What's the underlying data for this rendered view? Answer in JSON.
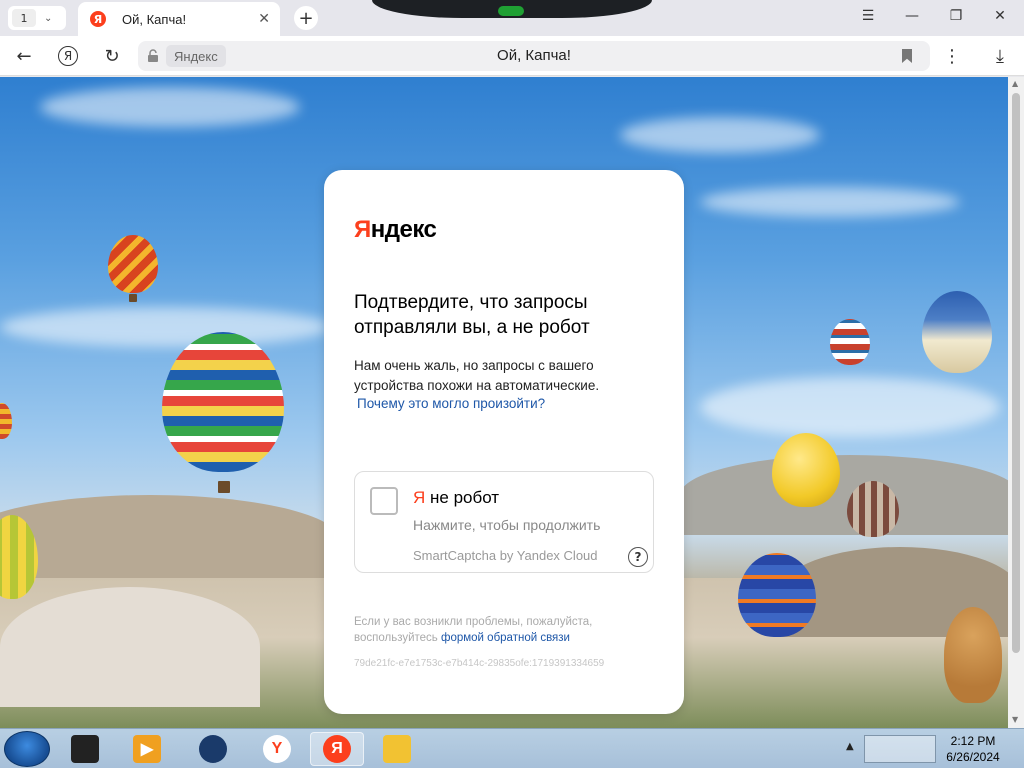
{
  "browser": {
    "tab_count": "1",
    "tab_title": "Ой, Капча!",
    "tab_favicon": "Я",
    "address_site_label": "Яндекс",
    "address_title": "Ой, Капча!"
  },
  "icons": {
    "back": "back-arrow-icon",
    "yandex": "yandex-circle-icon",
    "reload": "reload-icon",
    "lock": "lock-icon",
    "bookmark": "bookmark-icon",
    "menu": "kebab-menu-icon",
    "download": "download-icon"
  },
  "captcha": {
    "logo_red": "Я",
    "logo_rest": "ндекс",
    "heading": "Подтвердите, что запросы отправляли вы, а не робот",
    "description": "Нам очень жаль, но запросы с вашего устройства похожи на автоматические.",
    "why_link": "Почему это могло произойти?",
    "checkbox_label_red": "Я",
    "checkbox_label_rest": " не робот",
    "checkbox_hint": "Нажмите, чтобы продолжить",
    "brand": "SmartCaptcha by Yandex Cloud",
    "help": "?",
    "footer_text": "Если у вас возникли проблемы, пожалуйста, воспользуйтесь",
    "footer_link": "формой обратной связи",
    "request_id": "79de21fc-e7e1753c-e7b414c-29835ofe:1719391334659"
  },
  "taskbar": {
    "time": "2:12 PM",
    "date": "6/26/2024",
    "yandex_icon": "Я"
  },
  "colors": {
    "brand_red": "#fc3f1d",
    "link_blue": "#1e57a8"
  }
}
